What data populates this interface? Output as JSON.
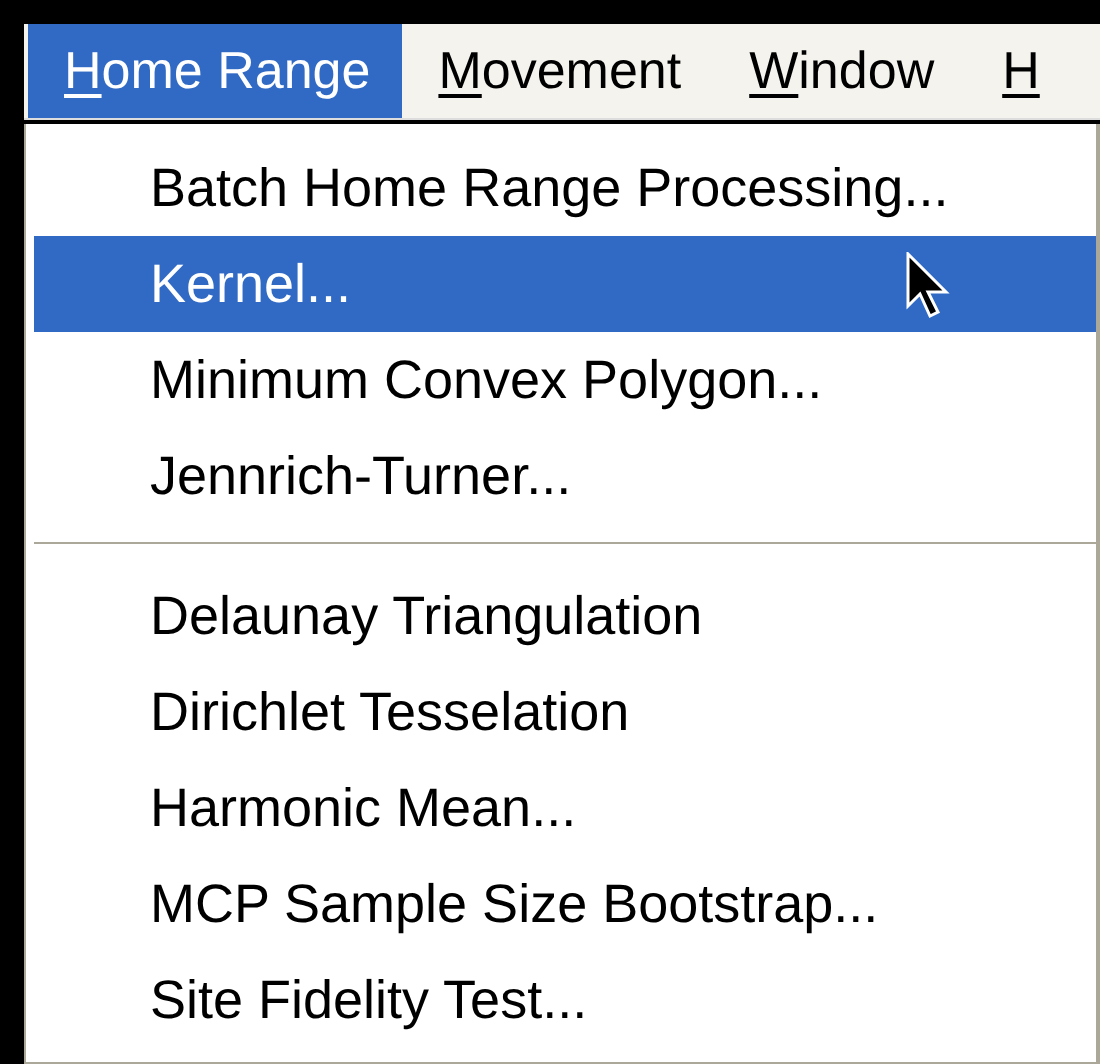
{
  "menu_bar": [
    {
      "access_key": "H",
      "rest": "ome Range",
      "selected": true
    },
    {
      "access_key": "M",
      "rest": "ovement",
      "selected": false
    },
    {
      "access_key": "W",
      "rest": "indow",
      "selected": false
    },
    {
      "access_key": "H",
      "selected": false
    }
  ],
  "menu": [
    {
      "kind": "item",
      "label": "Batch Home Range Processing...",
      "selected": false
    },
    {
      "kind": "item",
      "label": "Kernel...",
      "selected": true
    },
    {
      "kind": "item",
      "label": "Minimum Convex Polygon...",
      "selected": false
    },
    {
      "kind": "item",
      "label": "Jennrich-Turner...",
      "selected": false
    },
    {
      "kind": "separator"
    },
    {
      "kind": "item",
      "label": "Delaunay Triangulation",
      "selected": false
    },
    {
      "kind": "item",
      "label": "Dirichlet Tesselation",
      "selected": false
    },
    {
      "kind": "item",
      "label": "Harmonic Mean...",
      "selected": false
    },
    {
      "kind": "item",
      "label": "MCP Sample Size Bootstrap...",
      "selected": false
    },
    {
      "kind": "item",
      "label": "Site Fidelity Test...",
      "selected": false
    }
  ]
}
